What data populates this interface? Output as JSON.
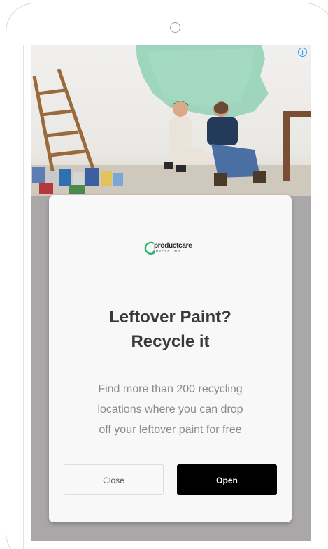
{
  "ad": {
    "info_icon": "info-icon",
    "brand": {
      "name": "productcare",
      "tagline": "RECYCLING",
      "accent_color": "#2bb673"
    },
    "headline_line1": "Leftover Paint?",
    "headline_line2": "Recycle it",
    "body_line1": "Find more than 200 recycling",
    "body_line2": "locations where you can drop",
    "body_line3": "off your leftover paint for free",
    "close_label": "Close",
    "open_label": "Open"
  },
  "colors": {
    "open_button": "#000000",
    "info_icon": "#2f9cf0",
    "backdrop": "#a9a7a8",
    "paint_swatch": "#8fd1b4"
  }
}
